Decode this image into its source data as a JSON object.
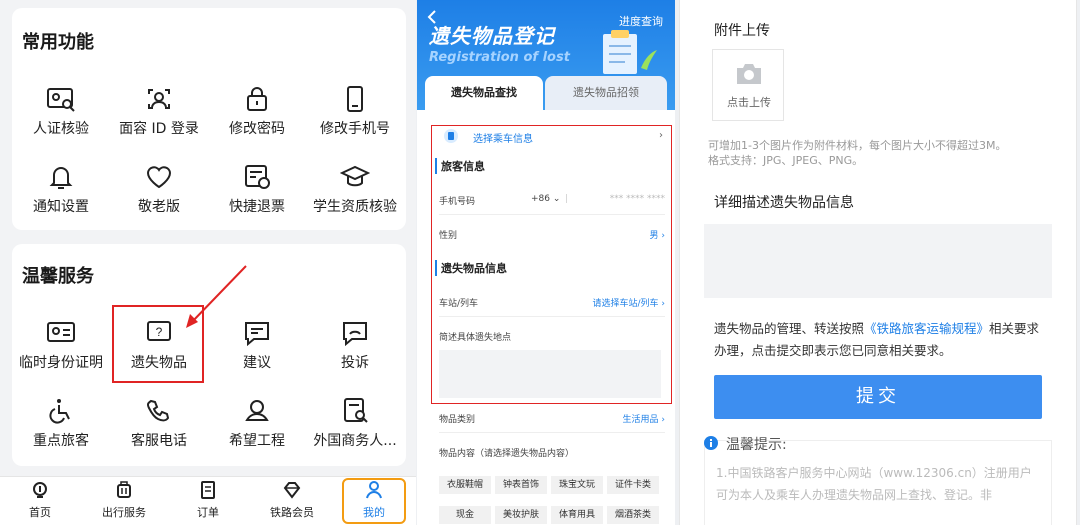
{
  "panel_common": {
    "title": "常用功能",
    "items": [
      {
        "label": "人证核验",
        "icon": "id-card-search-icon"
      },
      {
        "label": "面容 ID 登录",
        "icon": "face-id-icon"
      },
      {
        "label": "修改密码",
        "icon": "lock-icon"
      },
      {
        "label": "修改手机号",
        "icon": "phone-icon"
      },
      {
        "label": "通知设置",
        "icon": "bell-icon"
      },
      {
        "label": "敬老版",
        "icon": "heart-icon"
      },
      {
        "label": "快捷退票",
        "icon": "ticket-refund-icon"
      },
      {
        "label": "学生资质核验",
        "icon": "graduation-cap-icon"
      }
    ]
  },
  "panel_services": {
    "title": "温馨服务",
    "items": [
      {
        "label": "临时身份证明",
        "icon": "id-card-icon"
      },
      {
        "label": "遗失物品",
        "icon": "question-box-icon"
      },
      {
        "label": "建议",
        "icon": "message-icon"
      },
      {
        "label": "投诉",
        "icon": "complaint-icon"
      },
      {
        "label": "重点旅客",
        "icon": "wheelchair-icon"
      },
      {
        "label": "客服电话",
        "icon": "phone-call-icon"
      },
      {
        "label": "希望工程",
        "icon": "hope-project-icon"
      },
      {
        "label": "外国商务人...",
        "icon": "document-search-icon"
      }
    ]
  },
  "bottom_nav": {
    "items": [
      "首页",
      "出行服务",
      "订单",
      "铁路会员",
      "我的"
    ]
  },
  "lost_form": {
    "hero_title": "遗失物品登记",
    "hero_subtitle": "Registration of lost",
    "progress_link": "进度查询",
    "tabs": [
      "遗失物品查找",
      "遗失物品招领"
    ],
    "select_train_info": "选择乘车信息",
    "section_passenger": "旅客信息",
    "phone_label": "手机号码",
    "phone_code": "+86",
    "phone_value": "*** **** ****",
    "gender_label": "性别",
    "gender_value": "男",
    "section_item": "遗失物品信息",
    "station_label": "车站/列车",
    "station_value": "请选择车站/列车",
    "location_label": "简述具体遗失地点",
    "category_label": "物品类别",
    "category_value": "生活用品",
    "content_label": "物品内容（请选择遗失物品内容）",
    "chips": [
      "衣服鞋帽",
      "钟表首饰",
      "珠宝文玩",
      "证件卡类",
      "现金",
      "美妆护肤",
      "体育用具",
      "烟酒茶类"
    ]
  },
  "detail_form": {
    "attach_title": "附件上传",
    "upload_label": "点击上传",
    "attach_hint_1": "可增加1-3个图片作为附件材料，每个图片大小不得超过3M。",
    "attach_hint_2": "格式支持：JPG、JPEG、PNG。",
    "describe_title": "详细描述遗失物品信息",
    "rule_pre": "遗失物品的管理、转送按照",
    "rule_link": "《铁路旅客运输规程》",
    "rule_post": "相关要求办理，点击提交即表示您已同意相关要求。",
    "submit_label": "提交",
    "tip_title": "温馨提示:",
    "tip_body": "1.中国铁路客户服务中心网站（www.12306.cn）注册用户可为本人及乘车人办理遗失物品网上查找、登记。非"
  },
  "colors": {
    "accent": "#1e7fe6",
    "highlight_red": "#e02424",
    "highlight_orange": "#f39c12",
    "submit_blue": "#3d8ef0"
  }
}
